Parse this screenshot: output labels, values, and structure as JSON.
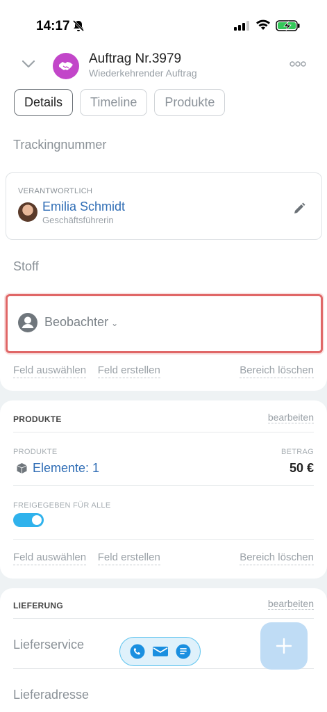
{
  "status_bar": {
    "time": "14:17"
  },
  "header": {
    "title": "Auftrag Nr.3979",
    "subtitle": "Wiederkehrender Auftrag"
  },
  "tabs": [
    {
      "label": "Details",
      "active": true
    },
    {
      "label": "Timeline",
      "active": false
    },
    {
      "label": "Produkte",
      "active": false
    }
  ],
  "fields": {
    "tracking": "Trackingnummer",
    "stoff": "Stoff"
  },
  "responsible": {
    "caption": "VERANTWORTLICH",
    "name": "Emilia Schmidt",
    "role": "Geschäftsführerin"
  },
  "observer": {
    "label": "Beobachter",
    "caret": "⌄"
  },
  "section_actions_1": {
    "select": "Feld auswählen",
    "create": "Feld erstellen",
    "delete": "Bereich löschen"
  },
  "products_section": {
    "title": "PRODUKTE",
    "edit": "bearbeiten",
    "products_caption": "PRODUKTE",
    "amount_caption": "BETRAG",
    "items_link": "Elemente: 1",
    "amount": "50 €",
    "shared_caption": "FREIGEGEBEN FÜR ALLE",
    "shared_on": true,
    "select": "Feld auswählen",
    "create": "Feld erstellen",
    "delete": "Bereich löschen"
  },
  "delivery_section": {
    "title": "LIEFERUNG",
    "edit": "bearbeiten",
    "service": "Lieferservice",
    "address": "Lieferadresse"
  },
  "colors": {
    "accent_blue": "#2f6db5",
    "deal_avatar": "#c246c9",
    "highlight_red": "#e06767",
    "toggle_on": "#2fb2ec"
  },
  "icons": [
    "bell-slash-icon",
    "signal-icon",
    "wifi-icon",
    "battery-charging-icon",
    "chevron-down-icon",
    "handshake-icon",
    "more-icon",
    "pencil-icon",
    "user-icon",
    "box-icon",
    "phone-icon",
    "mail-icon",
    "chat-icon",
    "plus-icon"
  ]
}
